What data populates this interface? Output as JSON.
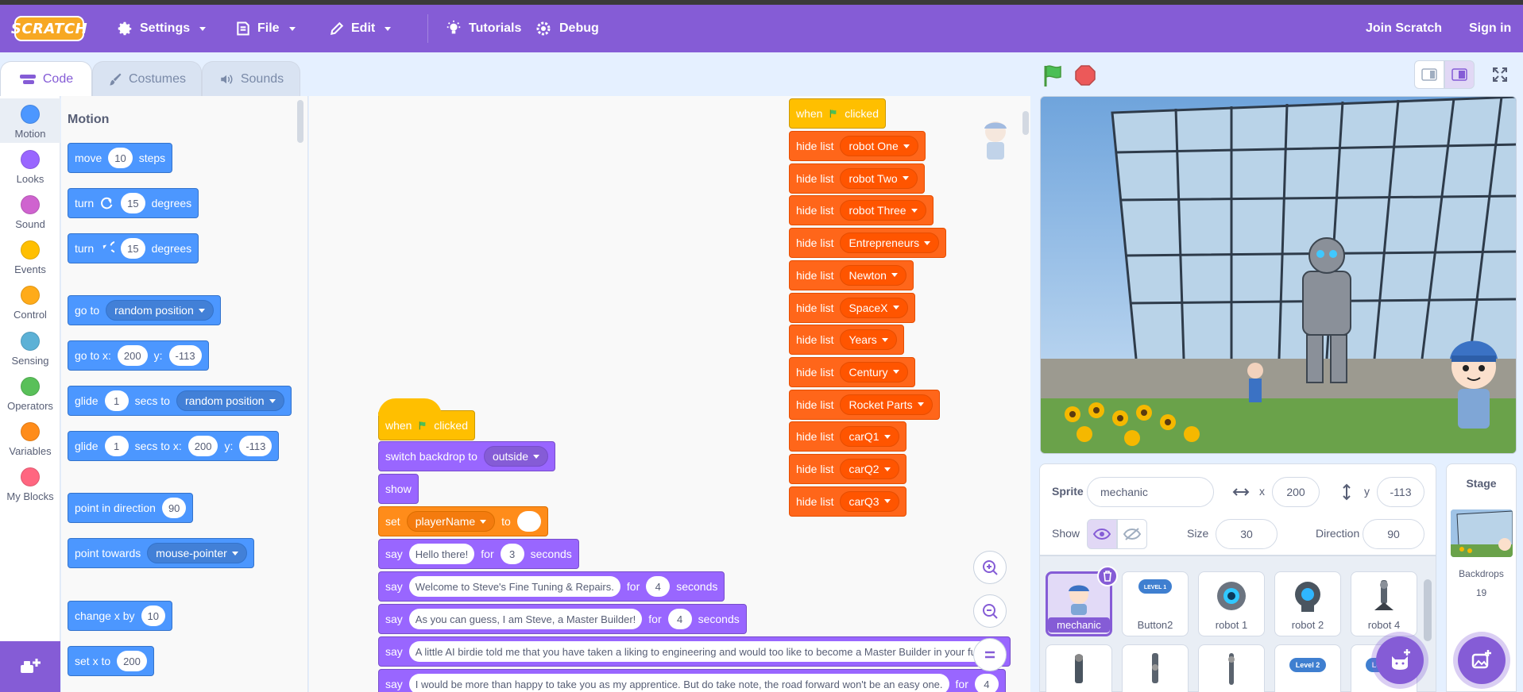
{
  "menu": {
    "logo": "SCRATCH",
    "settings": "Settings",
    "file": "File",
    "edit": "Edit",
    "tutorials": "Tutorials",
    "debug": "Debug",
    "join": "Join Scratch",
    "signin": "Sign in"
  },
  "tabs": {
    "code": "Code",
    "costumes": "Costumes",
    "sounds": "Sounds"
  },
  "categories": [
    {
      "label": "Motion",
      "color": "#4c97ff"
    },
    {
      "label": "Looks",
      "color": "#9966ff"
    },
    {
      "label": "Sound",
      "color": "#cf63cf"
    },
    {
      "label": "Events",
      "color": "#ffbf00"
    },
    {
      "label": "Control",
      "color": "#ffab19"
    },
    {
      "label": "Sensing",
      "color": "#5cb1d6"
    },
    {
      "label": "Operators",
      "color": "#59c059"
    },
    {
      "label": "Variables",
      "color": "#ff8c1a"
    },
    {
      "label": "My Blocks",
      "color": "#ff6680"
    }
  ],
  "palette": {
    "title": "Motion",
    "move": {
      "a": "move",
      "n": "10",
      "b": "steps"
    },
    "turn_right": {
      "a": "turn",
      "n": "15",
      "b": "degrees"
    },
    "turn_left": {
      "a": "turn",
      "n": "15",
      "b": "degrees"
    },
    "goto": {
      "a": "go to",
      "dd": "random position"
    },
    "gotoxy": {
      "a": "go to x:",
      "x": "200",
      "b": "y:",
      "y": "-113"
    },
    "glide": {
      "a": "glide",
      "n": "1",
      "b": "secs to",
      "dd": "random position"
    },
    "glidexy": {
      "a": "glide",
      "n": "1",
      "b": "secs to x:",
      "x": "200",
      "c": "y:",
      "y": "-113"
    },
    "point_dir": {
      "a": "point in direction",
      "n": "90"
    },
    "point_towards": {
      "a": "point towards",
      "dd": "mouse-pointer"
    },
    "change_x": {
      "a": "change x by",
      "n": "10"
    },
    "set_x": {
      "a": "set x to",
      "n": "200"
    }
  },
  "script1": {
    "when": "when",
    "clicked": "clicked",
    "switch": {
      "a": "switch backdrop to",
      "dd": "outside"
    },
    "show": "show",
    "set": {
      "a": "set",
      "dd": "playerName",
      "b": "to",
      "v": ""
    },
    "say": [
      {
        "a": "say",
        "text": "Hello there!",
        "for": "for",
        "n": "3",
        "b": "seconds"
      },
      {
        "a": "say",
        "text": "Welcome to Steve's Fine Tuning & Repairs.",
        "for": "for",
        "n": "4",
        "b": "seconds"
      },
      {
        "a": "say",
        "text": "As you can guess, I am Steve, a Master Builder!",
        "for": "for",
        "n": "4",
        "b": "seconds"
      },
      {
        "a": "say",
        "text": "A little AI birdie told me that you have taken a liking to engineering and would too like to become a Master Builder in your future."
      },
      {
        "a": "say",
        "text": "I would be more than happy to take you as my apprentice. But do take note, the road forward won't be an easy one.",
        "for": "for",
        "n": "4"
      }
    ]
  },
  "script2": {
    "when": "when",
    "clicked": "clicked",
    "hide_label": "hide list",
    "lists": [
      "robot One",
      "robot Two",
      "robot Three",
      "Entrepreneurs",
      "Newton",
      "SpaceX",
      "Years",
      "Century",
      "Rocket Parts",
      "carQ1",
      "carQ2",
      "carQ3"
    ]
  },
  "sprite_info": {
    "sprite_label": "Sprite",
    "sprite_name": "mechanic",
    "x_label": "x",
    "x": "200",
    "y_label": "y",
    "y": "-113",
    "show_label": "Show",
    "size_label": "Size",
    "size": "30",
    "direction_label": "Direction",
    "direction": "90"
  },
  "sprites": [
    "mechanic",
    "Button2",
    "robot 1",
    "robot 2",
    "robot 4"
  ],
  "sprite_thumb_labels": {
    "level1": "LEVEL 1",
    "level2": "Level 2"
  },
  "stage_panel": {
    "title": "Stage",
    "backdrops_label": "Backdrops",
    "backdrops_count": "19"
  },
  "colors": {
    "accent": "#855cd6",
    "motion": "#4c97ff",
    "looks": "#9966ff",
    "events": "#ffbf00",
    "variables": "#ff8c1a",
    "lists": "#ff661a"
  }
}
